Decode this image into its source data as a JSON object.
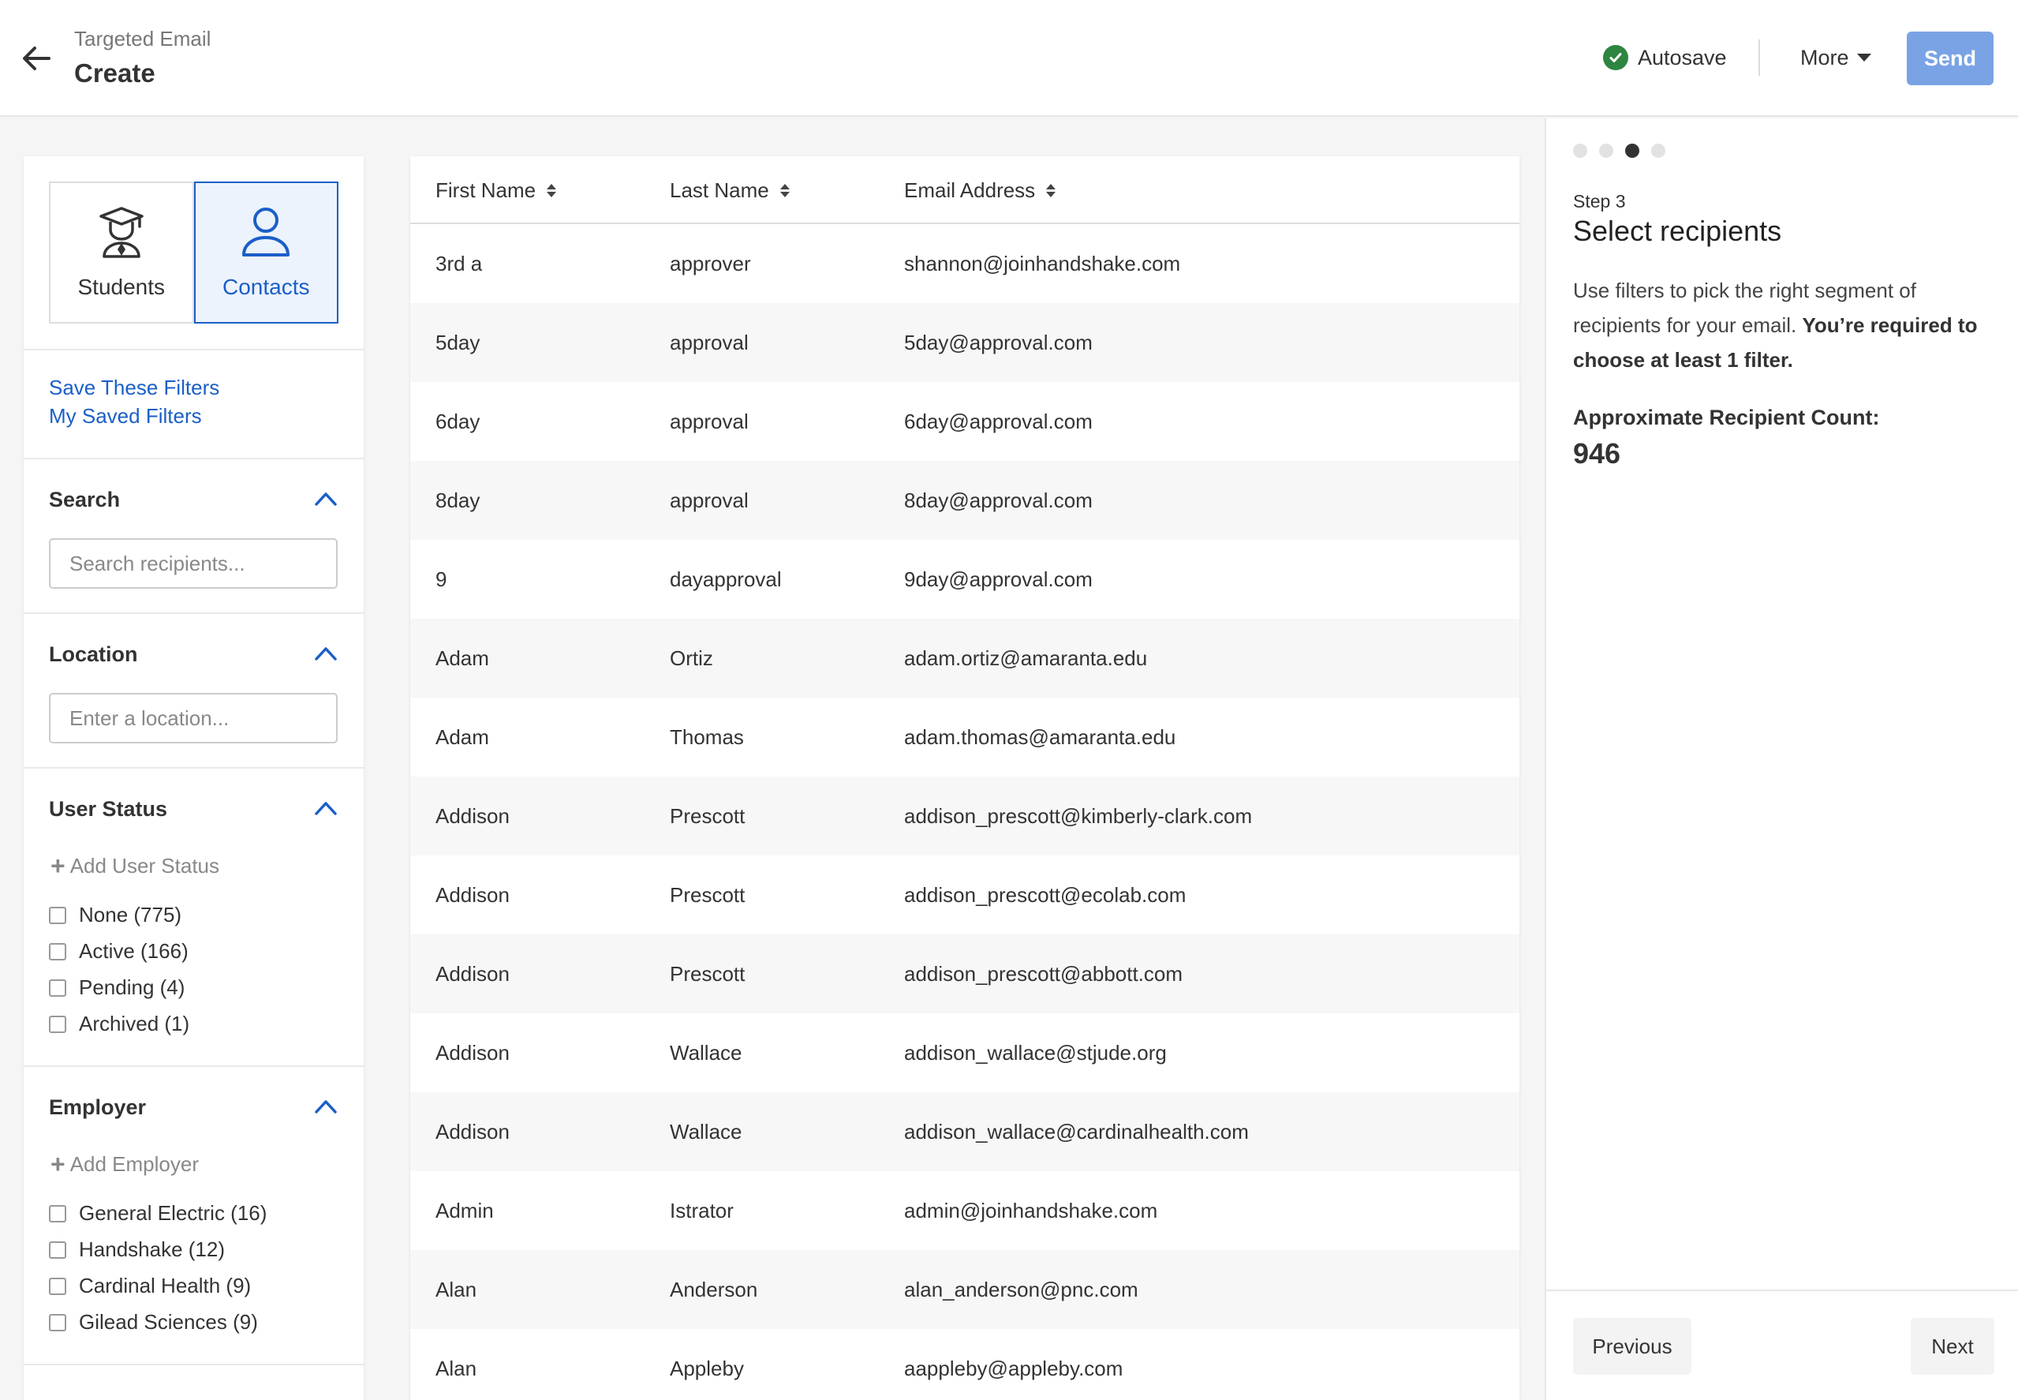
{
  "header": {
    "breadcrumb": "Targeted Email",
    "title": "Create",
    "autosave_label": "Autosave",
    "more_label": "More",
    "send_label": "Send"
  },
  "filters": {
    "toggle": {
      "students_label": "Students",
      "contacts_label": "Contacts",
      "selected": "Contacts"
    },
    "save_filters_link": "Save These Filters",
    "saved_filters_link": "My Saved Filters",
    "search": {
      "title": "Search",
      "placeholder": "Search recipients..."
    },
    "location": {
      "title": "Location",
      "placeholder": "Enter a location..."
    },
    "user_status": {
      "title": "User Status",
      "add_label": "Add User Status",
      "options": [
        {
          "label": "None (775)"
        },
        {
          "label": "Active (166)"
        },
        {
          "label": "Pending (4)"
        },
        {
          "label": "Archived (1)"
        }
      ]
    },
    "employer": {
      "title": "Employer",
      "add_label": "Add Employer",
      "options": [
        {
          "label": "General Electric (16)"
        },
        {
          "label": "Handshake (12)"
        },
        {
          "label": "Cardinal Health (9)"
        },
        {
          "label": "Gilead Sciences (9)"
        }
      ]
    }
  },
  "table": {
    "columns": [
      "First Name",
      "Last Name",
      "Email Address"
    ],
    "rows": [
      [
        "3rd a",
        "approver",
        "shannon@joinhandshake.com"
      ],
      [
        "5day",
        "approval",
        "5day@approval.com"
      ],
      [
        "6day",
        "approval",
        "6day@approval.com"
      ],
      [
        "8day",
        "approval",
        "8day@approval.com"
      ],
      [
        "9",
        "dayapproval",
        "9day@approval.com"
      ],
      [
        "Adam",
        "Ortiz",
        "adam.ortiz@amaranta.edu"
      ],
      [
        "Adam",
        "Thomas",
        "adam.thomas@amaranta.edu"
      ],
      [
        "Addison",
        "Prescott",
        "addison_prescott@kimberly-clark.com"
      ],
      [
        "Addison",
        "Prescott",
        "addison_prescott@ecolab.com"
      ],
      [
        "Addison",
        "Prescott",
        "addison_prescott@abbott.com"
      ],
      [
        "Addison",
        "Wallace",
        "addison_wallace@stjude.org"
      ],
      [
        "Addison",
        "Wallace",
        "addison_wallace@cardinalhealth.com"
      ],
      [
        "Admin",
        "Istrator",
        "admin@joinhandshake.com"
      ],
      [
        "Alan",
        "Anderson",
        "alan_anderson@pnc.com"
      ],
      [
        "Alan",
        "Appleby",
        "aappleby@appleby.com"
      ]
    ]
  },
  "wizard": {
    "total_steps": 4,
    "current_step": 3,
    "step_label": "Step 3",
    "title": "Select recipients",
    "description": "Use filters to pick the right segment of recipients for your email.",
    "description_bold": "You’re required to choose at least 1 filter.",
    "count_label": "Approximate Recipient Count:",
    "count_value": "946",
    "previous_label": "Previous",
    "next_label": "Next"
  },
  "colors": {
    "accent": "#1b5fc7",
    "send_button": "#7aa3e5",
    "autosave_check": "#2e8540"
  }
}
